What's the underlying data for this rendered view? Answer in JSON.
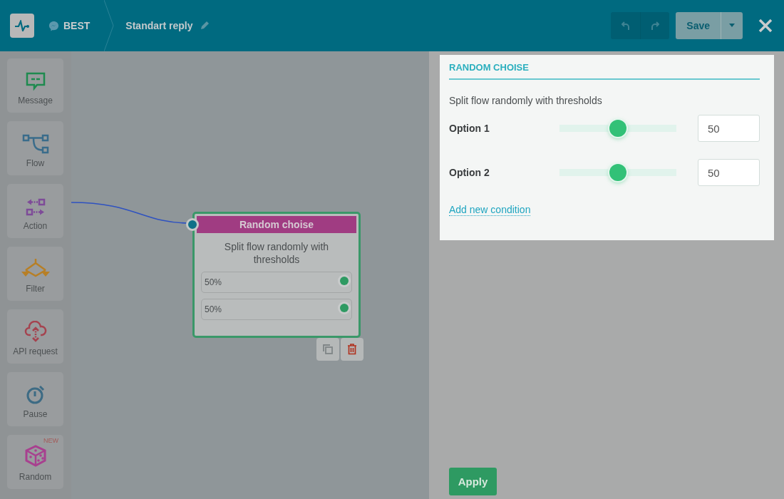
{
  "header": {
    "channel": "BEST",
    "title": "Standart reply",
    "save": "Save"
  },
  "sidebar": {
    "items": [
      {
        "label": "Message",
        "kind": "message"
      },
      {
        "label": "Flow",
        "kind": "flow"
      },
      {
        "label": "Action",
        "kind": "action"
      },
      {
        "label": "Filter",
        "kind": "filter"
      },
      {
        "label": "API request",
        "kind": "api"
      },
      {
        "label": "Pause",
        "kind": "pause"
      },
      {
        "label": "Random",
        "kind": "random",
        "badge": "NEW"
      }
    ]
  },
  "node": {
    "title": "Random choise",
    "description": "Split flow randomly with thresholds",
    "outputs": [
      {
        "label": "50%"
      },
      {
        "label": "50%"
      }
    ]
  },
  "panel": {
    "title": "RANDOM CHOISE",
    "description": "Split flow randomly with thresholds",
    "options": [
      {
        "label": "Option 1",
        "level": 0.5,
        "value": "50"
      },
      {
        "label": "Option 2",
        "level": 0.5,
        "value": "50"
      }
    ],
    "link": "Add new condition",
    "apply": "Apply"
  }
}
